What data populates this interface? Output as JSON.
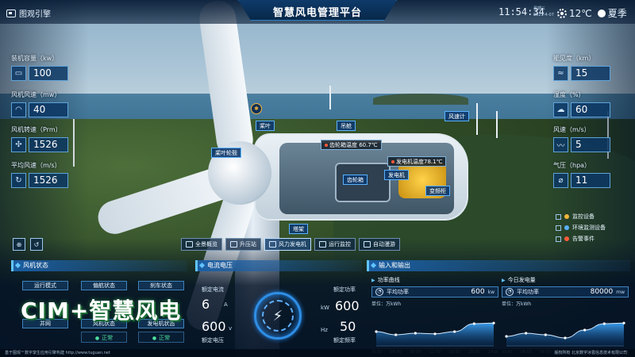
{
  "header": {
    "logo_text": "图观引擎",
    "title": "智慧风电管理平台",
    "time": "11:54:34",
    "weekday": "星期三",
    "date": "2023-4-07",
    "temperature": "12℃",
    "season": "夏季"
  },
  "left_stats": [
    {
      "label": "装机容量（kw）",
      "value": "100",
      "icon": "battery-icon",
      "glyph": "▭"
    },
    {
      "label": "风机风速（mw）",
      "value": "40",
      "icon": "wind-gauge-icon",
      "glyph": "◠"
    },
    {
      "label": "风机转速（Prm）",
      "value": "1526",
      "icon": "fan-icon",
      "glyph": "✣"
    },
    {
      "label": "平均风速（m/s）",
      "value": "1526",
      "icon": "refresh-icon",
      "glyph": "↻"
    }
  ],
  "right_stats": [
    {
      "label": "能见度（km）",
      "value": "15",
      "icon": "visibility-icon",
      "glyph": "≈"
    },
    {
      "label": "湿度（%）",
      "value": "60",
      "icon": "humidity-icon",
      "glyph": "☁"
    },
    {
      "label": "风速（m/s）",
      "value": "5",
      "icon": "wind-icon",
      "glyph": "〰"
    },
    {
      "label": "气压（hpa）",
      "value": "11",
      "icon": "pressure-icon",
      "glyph": "⌀"
    }
  ],
  "callouts": {
    "blade": "桨叶",
    "nacelle": "吊舱",
    "anemometer": "风速计",
    "hub": "桨叶轮毂",
    "gearbox": "齿轮箱",
    "generator": "发电机",
    "converter": "变频柜",
    "tower": "塔架",
    "gearbox_temp": "齿轮箱温度 60.7℃",
    "generator_temp": "发电机温度78.1℃"
  },
  "nav": [
    {
      "label": "全景概览",
      "active": false
    },
    {
      "label": "升压站",
      "active": false
    },
    {
      "label": "风力发电机",
      "active": true
    },
    {
      "label": "运行监控",
      "active": false
    },
    {
      "label": "自动漫游",
      "active": false
    }
  ],
  "legend": [
    {
      "label": "监控设备",
      "color": "#f2b43b"
    },
    {
      "label": "环境监测设备",
      "color": "#5ab2ff"
    },
    {
      "label": "告警事件",
      "color": "#ff5a3a"
    }
  ],
  "fan_status": {
    "title": "风机状态",
    "cells": [
      {
        "label": "运行模式",
        "value": ""
      },
      {
        "label": "偏航状态",
        "value": ""
      },
      {
        "label": "刹车状态",
        "value": ""
      },
      {
        "label": "并网",
        "value": ""
      },
      {
        "label": "风机状态",
        "value": "正常"
      },
      {
        "label": "发电机状态",
        "value": "正常"
      }
    ]
  },
  "watermark": "CIM+智慧风电",
  "electric": {
    "title": "电流电压",
    "current_label": "额定电流",
    "current_value": "6",
    "current_unit": "A",
    "voltage_label": "额定电压",
    "voltage_value": "600",
    "voltage_unit": "v",
    "power_label": "额定功率",
    "power_value": "600",
    "power_unit": "kW",
    "freq_label": "额定频率",
    "freq_value": "50",
    "freq_unit": "Hz"
  },
  "io": {
    "title": "输入和输出",
    "power_curve": {
      "title": "功率曲线",
      "kv_label": "平均功率",
      "kv_value": "600",
      "kv_unit": "kw",
      "unit": "单位：万kWh"
    },
    "daily_output": {
      "title": "今日发电量",
      "kv_label": "平均功率",
      "kv_value": "80000",
      "kv_unit": "mw",
      "unit": "单位：万kWh"
    }
  },
  "chart_data": [
    {
      "type": "area",
      "x": [
        "00:00",
        "04:00",
        "08:00",
        "12:00",
        "16:00",
        "20:00",
        "24:00"
      ],
      "series": [
        {
          "values": [
            0.45,
            0.35,
            0.4,
            0.38,
            0.45,
            0.7,
            0.72
          ]
        }
      ],
      "ylim": [
        0,
        1
      ]
    },
    {
      "type": "area",
      "x": [
        "00:00",
        "04:00",
        "08:00",
        "12:00",
        "16:00",
        "20:00",
        "24:00"
      ],
      "series": [
        {
          "values": [
            0.3,
            0.4,
            0.35,
            0.25,
            0.5,
            0.7,
            0.72
          ]
        }
      ],
      "ylim": [
        0,
        1
      ]
    }
  ],
  "footer": {
    "left": "基于图观™数字孪生应用引擎构建 http://www.tuguan.net",
    "right": "版权所有 北京数字冰雹信息技术有限公司"
  }
}
